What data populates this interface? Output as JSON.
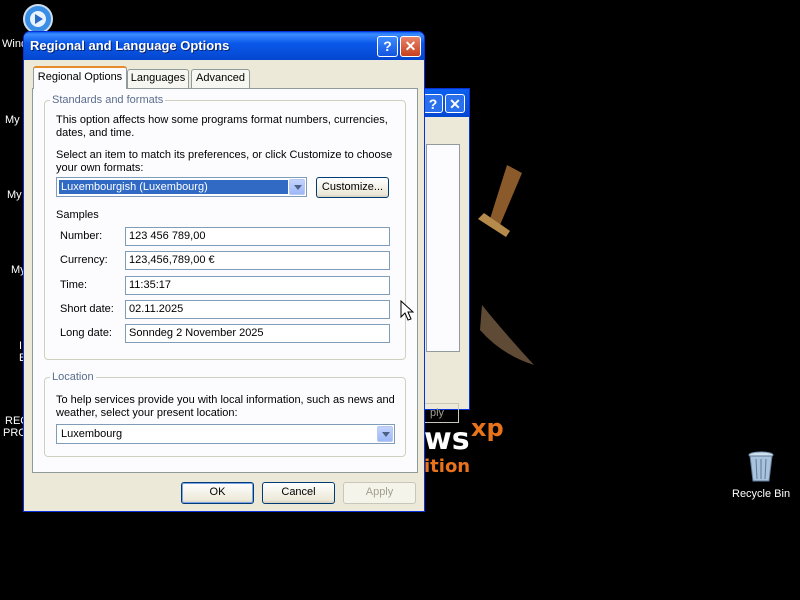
{
  "desktop": {
    "icons": [
      {
        "label": "Wind",
        "icon": "media-player-icon"
      },
      {
        "label": "My",
        "icon": "folder-icon"
      },
      {
        "label": "My",
        "icon": "computer-icon"
      },
      {
        "label": "My",
        "icon": "network-icon"
      },
      {
        "label": "I",
        "icon": "internet-icon"
      },
      {
        "label": "E",
        "icon": "internet-icon"
      },
      {
        "label": "REC",
        "icon": "app-icon"
      },
      {
        "label": "PRO",
        "icon": "app-icon"
      }
    ],
    "recycle_bin": "Recycle Bin",
    "brand_ws": "ws",
    "brand_xp": "xp",
    "brand_edition": "ition",
    "back_apply": "ply",
    "back_help": "?",
    "back_close": "✕"
  },
  "dialog": {
    "title": "Regional and Language Options",
    "help": "?",
    "close": "✕",
    "tabs": [
      "Regional Options",
      "Languages",
      "Advanced"
    ],
    "standards": {
      "title": "Standards and formats",
      "desc": [
        "This option affects how some programs format numbers, currencies,",
        "dates, and time."
      ],
      "select_desc": [
        "Select an item to match its preferences, or click Customize to choose",
        "your own formats:"
      ],
      "selected_format": "Luxembourgish (Luxembourg)",
      "customize": "Customize...",
      "samples_title": "Samples",
      "samples": [
        {
          "label": "Number:",
          "value": "123 456 789,00"
        },
        {
          "label": "Currency:",
          "value": "123,456,789,00 €"
        },
        {
          "label": "Time:",
          "value": "11:35:17"
        },
        {
          "label": "Short date:",
          "value": "02.11.2025"
        },
        {
          "label": "Long date:",
          "value": "Sonndeg 2 November 2025"
        }
      ]
    },
    "location": {
      "title": "Location",
      "desc": [
        "To help services provide you with local information, such as news and",
        "weather, select your present location:"
      ],
      "selected": "Luxembourg"
    },
    "buttons": {
      "ok": "OK",
      "cancel": "Cancel",
      "apply": "Apply"
    }
  },
  "colors": {
    "titlebar": "#0a58ea",
    "dialog_bg": "#ece9d8",
    "brand_orange": "#e8731a"
  }
}
